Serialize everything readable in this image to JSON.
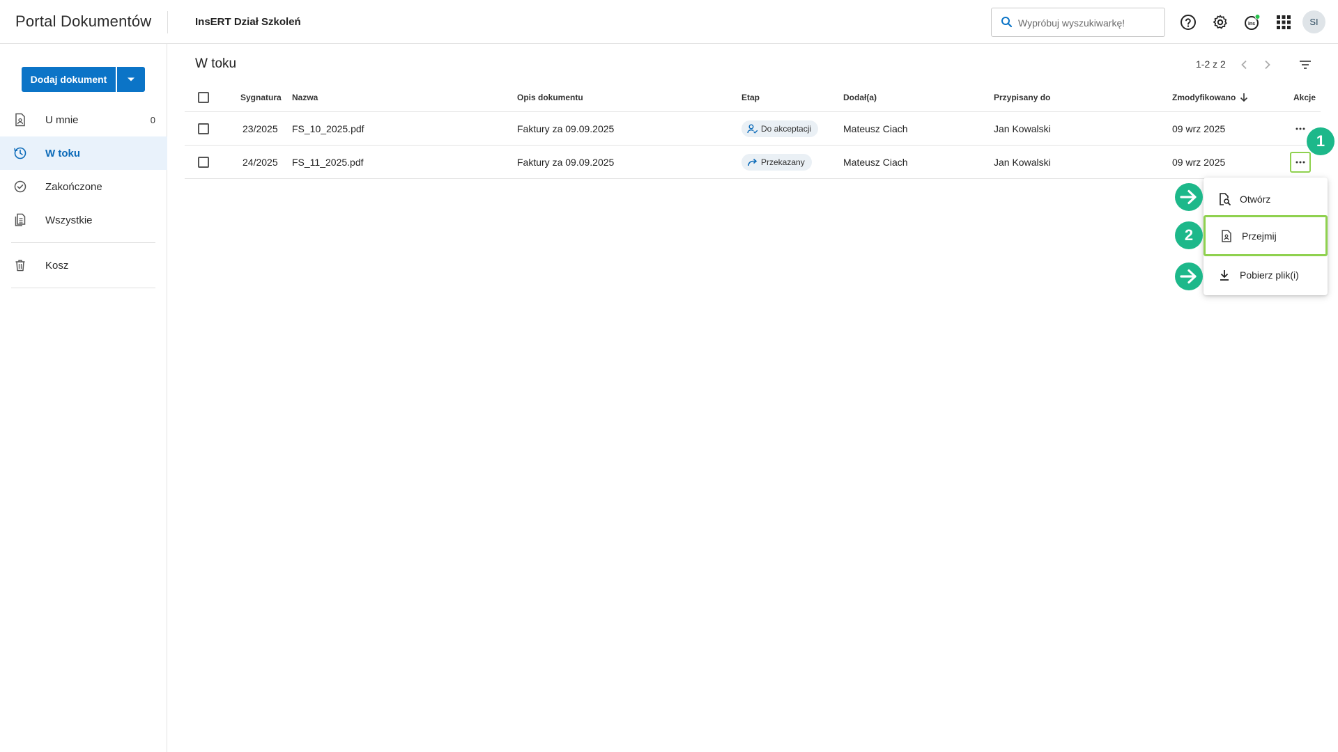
{
  "header": {
    "app_title": "Portal Dokumentów",
    "org_name": "InsERT Dział Szkoleń",
    "search_placeholder": "Wypróbuj wyszukiwarkę!",
    "avatar_initials": "SI"
  },
  "sidebar": {
    "add_button_label": "Dodaj dokument",
    "items": [
      {
        "label": "U mnie",
        "count": "0",
        "icon": "document-user-icon"
      },
      {
        "label": "W toku",
        "count": "",
        "icon": "clock-icon",
        "active": true
      },
      {
        "label": "Zakończone",
        "count": "",
        "icon": "check-circle-icon"
      },
      {
        "label": "Wszystkie",
        "count": "",
        "icon": "documents-icon"
      },
      {
        "label": "Kosz",
        "count": "",
        "icon": "trash-icon"
      }
    ]
  },
  "main": {
    "title": "W toku",
    "pager": "1-2 z 2",
    "table": {
      "headers": {
        "signature": "Sygnatura",
        "name": "Nazwa",
        "description": "Opis dokumentu",
        "stage": "Etap",
        "added_by": "Dodał(a)",
        "assigned_to": "Przypisany do",
        "modified": "Zmodyfikowano",
        "actions": "Akcje"
      },
      "rows": [
        {
          "signature": "23/2025",
          "name": "FS_10_2025.pdf",
          "description": "Faktury za 09.09.2025",
          "stage": "Do akceptacji",
          "added_by": "Mateusz Ciach",
          "assigned_to": "Jan Kowalski",
          "modified": "09 wrz 2025"
        },
        {
          "signature": "24/2025",
          "name": "FS_11_2025.pdf",
          "description": "Faktury za 09.09.2025",
          "stage": "Przekazany",
          "added_by": "Mateusz Ciach",
          "assigned_to": "Jan Kowalski",
          "modified": "09 wrz 2025"
        }
      ]
    }
  },
  "context_menu": {
    "items": [
      {
        "label": "Otwórz",
        "icon": "file-search-icon"
      },
      {
        "label": "Przejmij",
        "icon": "file-user-icon"
      },
      {
        "label": "Pobierz plik(i)",
        "icon": "download-icon"
      }
    ]
  },
  "markers": {
    "step1": "1",
    "step2": "2"
  },
  "colors": {
    "accent": "#0b74c7",
    "highlight": "#8fd14f",
    "marker": "#1db88a",
    "active_bg": "#e9f2fb"
  }
}
